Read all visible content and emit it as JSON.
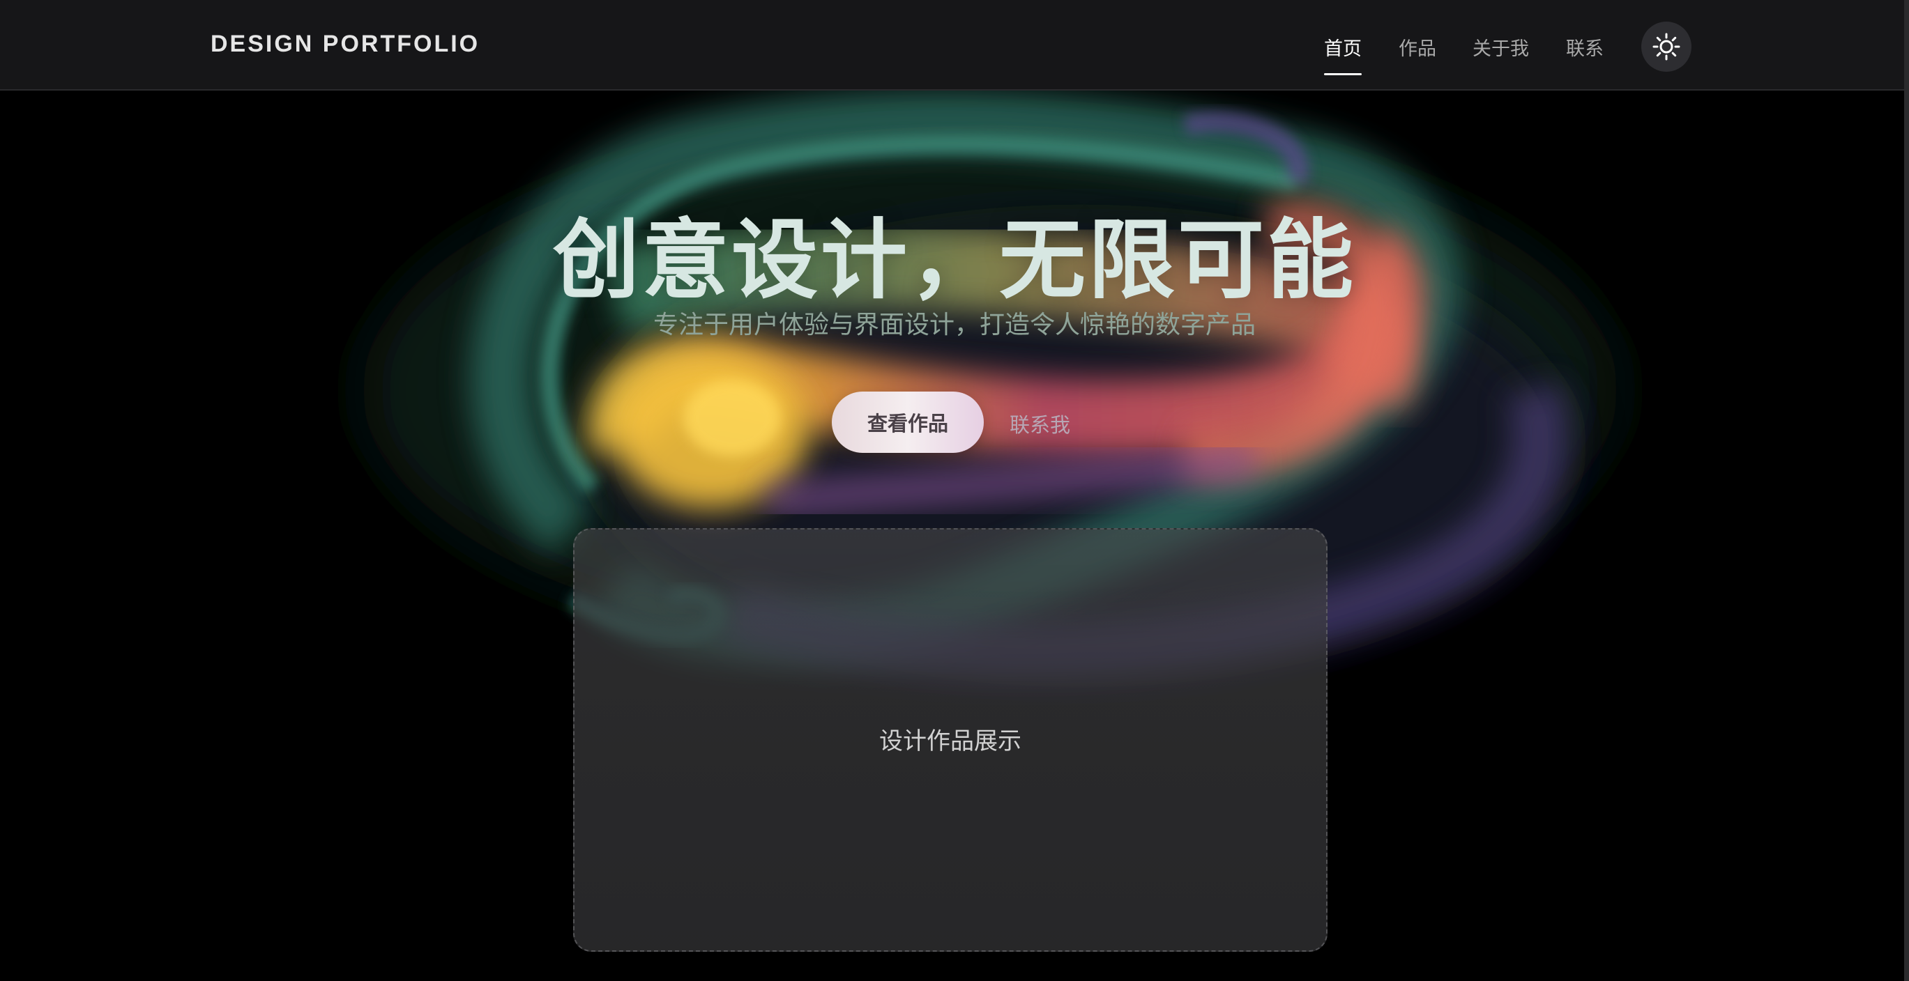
{
  "brand": "DESIGN PORTFOLIO",
  "nav": {
    "items": [
      {
        "label": "首页",
        "active": true
      },
      {
        "label": "作品",
        "active": false
      },
      {
        "label": "关于我",
        "active": false
      },
      {
        "label": "联系",
        "active": false
      }
    ],
    "theme_toggle_icon": "sun-icon"
  },
  "hero": {
    "title": "创意设计，无限可能",
    "subtitle": "专注于用户体验与界面设计，打造令人惊艳的数字产品",
    "primary_button": "查看作品",
    "secondary_link": "联系我"
  },
  "showcase": {
    "label": "设计作品展示"
  },
  "colors": {
    "background": "#000000",
    "navbar": "#161618",
    "title": "#d7e7e2",
    "subtitle": "#8fa499",
    "smoke_teal": "#2f7a6a",
    "smoke_yellow": "#f2c23a",
    "smoke_coral": "#e0685c",
    "smoke_purple": "#6a4f9a"
  }
}
